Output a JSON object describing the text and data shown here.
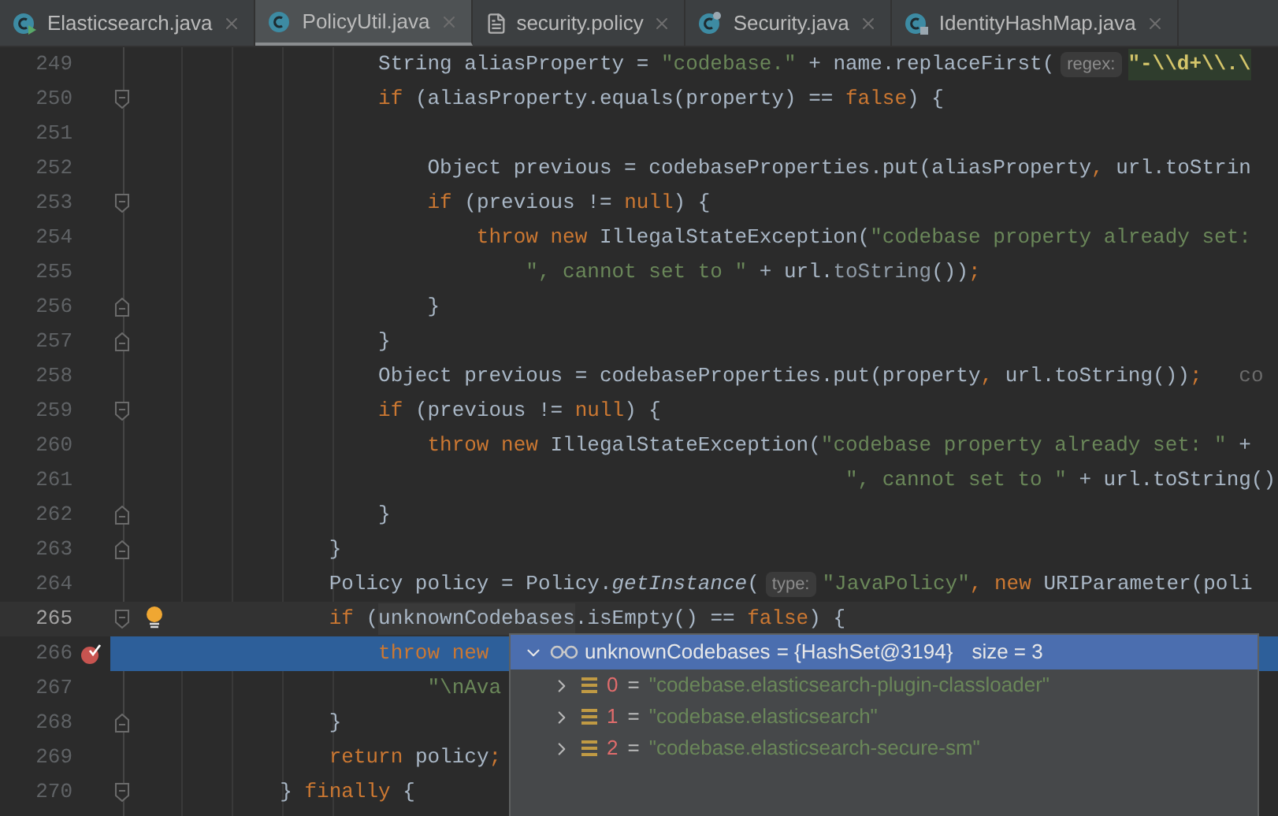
{
  "tabs": [
    {
      "label": "Elasticsearch.java",
      "kind": "class-run",
      "selected": false
    },
    {
      "label": "PolicyUtil.java",
      "kind": "class",
      "selected": true
    },
    {
      "label": "security.policy",
      "kind": "file",
      "selected": false
    },
    {
      "label": "Security.java",
      "kind": "class-lib",
      "selected": false
    },
    {
      "label": "IdentityHashMap.java",
      "kind": "class-locked",
      "selected": false
    }
  ],
  "editor": {
    "lines": [
      {
        "number": "249",
        "kind": "plain",
        "tokens": [
          {
            "kind": "plain",
            "text": "                    String aliasProperty = "
          },
          {
            "kind": "str",
            "text": "\"codebase.\""
          },
          {
            "kind": "plain",
            "text": " + name.replaceFirst("
          },
          {
            "kind": "hint",
            "text": "regex:"
          },
          {
            "kind": "regex",
            "text": "\"-\\\\d+\\\\.\\"
          }
        ]
      },
      {
        "number": "250",
        "kind": "fold-start",
        "tokens": [
          {
            "kind": "kw",
            "text": "                    if"
          },
          {
            "kind": "plain",
            "text": " (aliasProperty.equals(property) == "
          },
          {
            "kind": "kw",
            "text": "false"
          },
          {
            "kind": "plain",
            "text": ") {"
          }
        ]
      },
      {
        "number": "251",
        "kind": "plain"
      },
      {
        "number": "252",
        "kind": "plain",
        "tokens": [
          {
            "kind": "plain",
            "text": "                        Object previous = codebaseProperties.put(aliasProperty"
          },
          {
            "kind": "kw",
            "text": ","
          },
          {
            "kind": "plain",
            "text": " url.toStrin"
          }
        ]
      },
      {
        "number": "253",
        "kind": "fold-start",
        "tokens": [
          {
            "kind": "kw",
            "text": "                        if"
          },
          {
            "kind": "plain",
            "text": " (previous != "
          },
          {
            "kind": "kw",
            "text": "null"
          },
          {
            "kind": "plain",
            "text": ") {"
          }
        ]
      },
      {
        "number": "254",
        "kind": "plain",
        "tokens": [
          {
            "kind": "kw",
            "text": "                            throw new"
          },
          {
            "kind": "plain",
            "text": " IllegalStateException("
          },
          {
            "kind": "str",
            "text": "\"codebase property already set:"
          }
        ]
      },
      {
        "number": "255",
        "kind": "plain",
        "tokens": [
          {
            "kind": "str",
            "text": "                                \", cannot set to \""
          },
          {
            "kind": "plain",
            "text": " + url."
          },
          {
            "kind": "call",
            "text": "toString"
          },
          {
            "kind": "plain",
            "text": "())"
          },
          {
            "kind": "kw",
            "text": ";"
          }
        ]
      },
      {
        "number": "256",
        "kind": "fold-end",
        "tokens": [
          {
            "kind": "plain",
            "text": "                        }"
          }
        ]
      },
      {
        "number": "257",
        "kind": "fold-end",
        "tokens": [
          {
            "kind": "plain",
            "text": "                    }"
          }
        ]
      },
      {
        "number": "258",
        "kind": "plain",
        "tokens": [
          {
            "kind": "plain",
            "text": "                    Object previous = codebaseProperties.put(property"
          },
          {
            "kind": "kw",
            "text": ","
          },
          {
            "kind": "plain",
            "text": " url.toString())"
          },
          {
            "kind": "kw",
            "text": ";"
          },
          {
            "kind": "faded",
            "text": "   co"
          }
        ]
      },
      {
        "number": "259",
        "kind": "fold-start",
        "tokens": [
          {
            "kind": "kw",
            "text": "                    if"
          },
          {
            "kind": "plain",
            "text": " (previous != "
          },
          {
            "kind": "kw",
            "text": "null"
          },
          {
            "kind": "plain",
            "text": ") {"
          }
        ]
      },
      {
        "number": "260",
        "kind": "plain",
        "tokens": [
          {
            "kind": "kw",
            "text": "                        throw new"
          },
          {
            "kind": "plain",
            "text": " IllegalStateException("
          },
          {
            "kind": "str",
            "text": "\"codebase property already set: \""
          },
          {
            "kind": "plain",
            "text": " +"
          }
        ]
      },
      {
        "number": "261",
        "kind": "plain",
        "tokens": [
          {
            "kind": "str",
            "text": "                                                          \", cannot set to \""
          },
          {
            "kind": "plain",
            "text": " + url.toString()"
          }
        ]
      },
      {
        "number": "262",
        "kind": "fold-end",
        "tokens": [
          {
            "kind": "plain",
            "text": "                    }"
          }
        ]
      },
      {
        "number": "263",
        "kind": "fold-end",
        "tokens": [
          {
            "kind": "plain",
            "text": "                }"
          }
        ]
      },
      {
        "number": "264",
        "kind": "plain",
        "tokens": [
          {
            "kind": "plain",
            "text": "                Policy policy = Policy."
          },
          {
            "kind": "italic",
            "text": "getInstance"
          },
          {
            "kind": "plain",
            "text": "("
          },
          {
            "kind": "hint",
            "text": "type:"
          },
          {
            "kind": "str",
            "text": "\"JavaPolicy\""
          },
          {
            "kind": "kw",
            "text": ", new"
          },
          {
            "kind": "plain",
            "text": " URIParameter(poli"
          }
        ]
      },
      {
        "number": "265",
        "kind": "fold-start",
        "intention": true,
        "caret": true,
        "tokens": [
          {
            "kind": "kw",
            "text": "                if"
          },
          {
            "kind": "plain",
            "text": " ("
          },
          {
            "kind": "usage",
            "text": "unknownCodebases"
          },
          {
            "kind": "plain",
            "text": ".isEmpty() == "
          },
          {
            "kind": "kw",
            "text": "false"
          },
          {
            "kind": "plain",
            "text": ") {"
          }
        ]
      },
      {
        "number": "266",
        "kind": "plain",
        "breakpoint": true,
        "execution": true,
        "tokens": [
          {
            "kind": "kw",
            "text": "                    throw new"
          }
        ]
      },
      {
        "number": "267",
        "kind": "plain",
        "tokens": [
          {
            "kind": "str",
            "text": "                        \"\\nAva"
          }
        ]
      },
      {
        "number": "268",
        "kind": "fold-end",
        "tokens": [
          {
            "kind": "plain",
            "text": "                }"
          }
        ]
      },
      {
        "number": "269",
        "kind": "plain",
        "tokens": [
          {
            "kind": "kw",
            "text": "                return"
          },
          {
            "kind": "plain",
            "text": " policy"
          },
          {
            "kind": "kw",
            "text": ";"
          }
        ]
      },
      {
        "number": "270",
        "kind": "fold-start",
        "tokens": [
          {
            "kind": "plain",
            "text": "            } "
          },
          {
            "kind": "kw",
            "text": "finally"
          },
          {
            "kind": "plain",
            "text": " {"
          }
        ]
      }
    ]
  },
  "debug_popup": {
    "expanded": true,
    "name": "unknownCodebases",
    "value": "= {HashSet@3194}",
    "size": "size = 3",
    "items": [
      {
        "index": "0",
        "equals": "=",
        "value": "\"codebase.elasticsearch-plugin-classloader\"",
        "expanded": false
      },
      {
        "index": "1",
        "equals": "=",
        "value": "\"codebase.elasticsearch\"",
        "expanded": false
      },
      {
        "index": "2",
        "equals": "=",
        "value": "\"codebase.elasticsearch-secure-sm\"",
        "expanded": false
      }
    ]
  }
}
